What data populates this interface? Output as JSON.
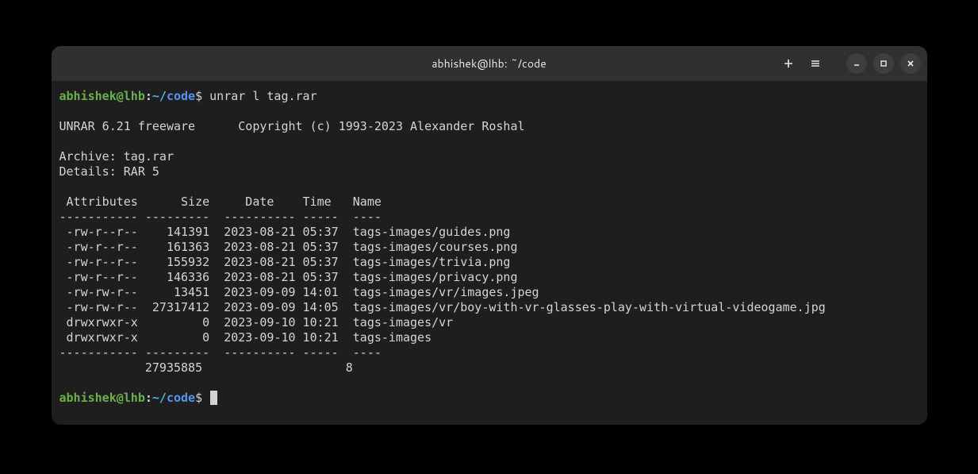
{
  "window": {
    "title": "abhishek@lhb: ~/code"
  },
  "prompt": {
    "user_host": "abhishek@lhb",
    "tilde": "~/",
    "path": "code",
    "dollar": "$"
  },
  "command": " unrar l tag.rar",
  "output": {
    "header": "UNRAR 6.21 freeware      Copyright (c) 1993-2023 Alexander Roshal",
    "archive_line": "Archive: tag.rar",
    "details_line": "Details: RAR 5",
    "column_header": " Attributes      Size     Date    Time   Name",
    "divider": "----------- ---------  ---------- -----  ----",
    "rows": [
      " -rw-r--r--    141391  2023-08-21 05:37  tags-images/guides.png",
      " -rw-r--r--    161363  2023-08-21 05:37  tags-images/courses.png",
      " -rw-r--r--    155932  2023-08-21 05:37  tags-images/trivia.png",
      " -rw-r--r--    146336  2023-08-21 05:37  tags-images/privacy.png",
      " -rw-rw-r--     13451  2023-09-09 14:01  tags-images/vr/images.jpeg",
      " -rw-rw-r--  27317412  2023-09-09 14:05  tags-images/vr/boy-with-vr-glasses-play-with-virtual-videogame.jpg",
      " drwxrwxr-x         0  2023-09-10 10:21  tags-images/vr",
      " drwxrwxr-x         0  2023-09-10 10:21  tags-images"
    ],
    "summary": "            27935885                    8"
  }
}
